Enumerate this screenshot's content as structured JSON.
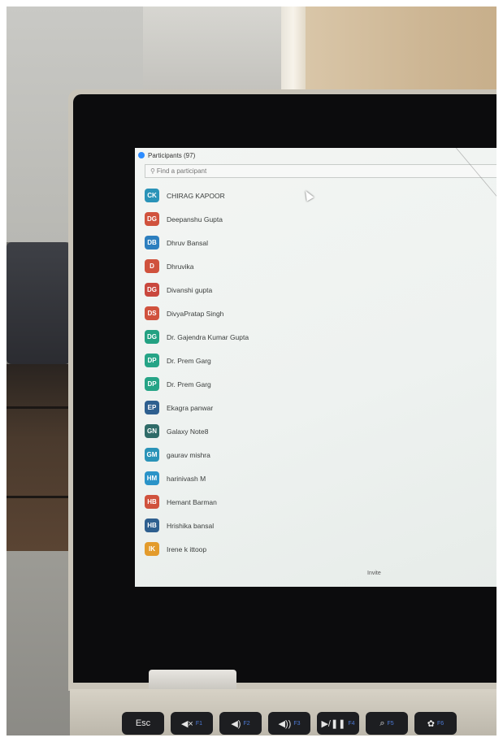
{
  "panel": {
    "title": "Participants (97)",
    "search_placeholder": "Find a participant",
    "invite_label": "Invite"
  },
  "participants": [
    {
      "initials": "CK",
      "name": "CHIRAG KAPOOR",
      "color": "#2a93b8"
    },
    {
      "initials": "DG",
      "name": "Deepanshu Gupta",
      "color": "#d0523d"
    },
    {
      "initials": "DB",
      "name": "Dhruv Bansal",
      "color": "#2d7fbf"
    },
    {
      "initials": "D",
      "name": "Dhruvika",
      "color": "#d0523d"
    },
    {
      "initials": "DG",
      "name": "Divanshi gupta",
      "color": "#c9483e"
    },
    {
      "initials": "DS",
      "name": "DivyaPratap Singh",
      "color": "#d0523d"
    },
    {
      "initials": "DG",
      "name": "Dr. Gajendra Kumar Gupta",
      "color": "#23a182"
    },
    {
      "initials": "DP",
      "name": "Dr. Prem Garg",
      "color": "#26a486"
    },
    {
      "initials": "DP",
      "name": "Dr. Prem Garg",
      "color": "#26a486"
    },
    {
      "initials": "EP",
      "name": "Ekagra panwar",
      "color": "#2e5f8f"
    },
    {
      "initials": "GN",
      "name": "Galaxy Note8",
      "color": "#2f6b68"
    },
    {
      "initials": "GM",
      "name": "gaurav mishra",
      "color": "#2a93b8"
    },
    {
      "initials": "HM",
      "name": "harinivash M",
      "color": "#2a93c8"
    },
    {
      "initials": "HB",
      "name": "Hemant Barman",
      "color": "#d0523d"
    },
    {
      "initials": "HB",
      "name": "Hrishika bansal",
      "color": "#2e5f8f"
    },
    {
      "initials": "IK",
      "name": "Irene k  ittoop",
      "color": "#e39b2c"
    }
  ],
  "keyboard": {
    "keys": [
      {
        "label": "Esc",
        "fn": ""
      },
      {
        "label": "◀×",
        "fn": "F1"
      },
      {
        "label": "◀)",
        "fn": "F2"
      },
      {
        "label": "◀))",
        "fn": "F3"
      },
      {
        "label": "▶/❚❚",
        "fn": "F4"
      },
      {
        "label": "⌕",
        "fn": "F5"
      },
      {
        "label": "✿",
        "fn": "F6"
      }
    ]
  }
}
